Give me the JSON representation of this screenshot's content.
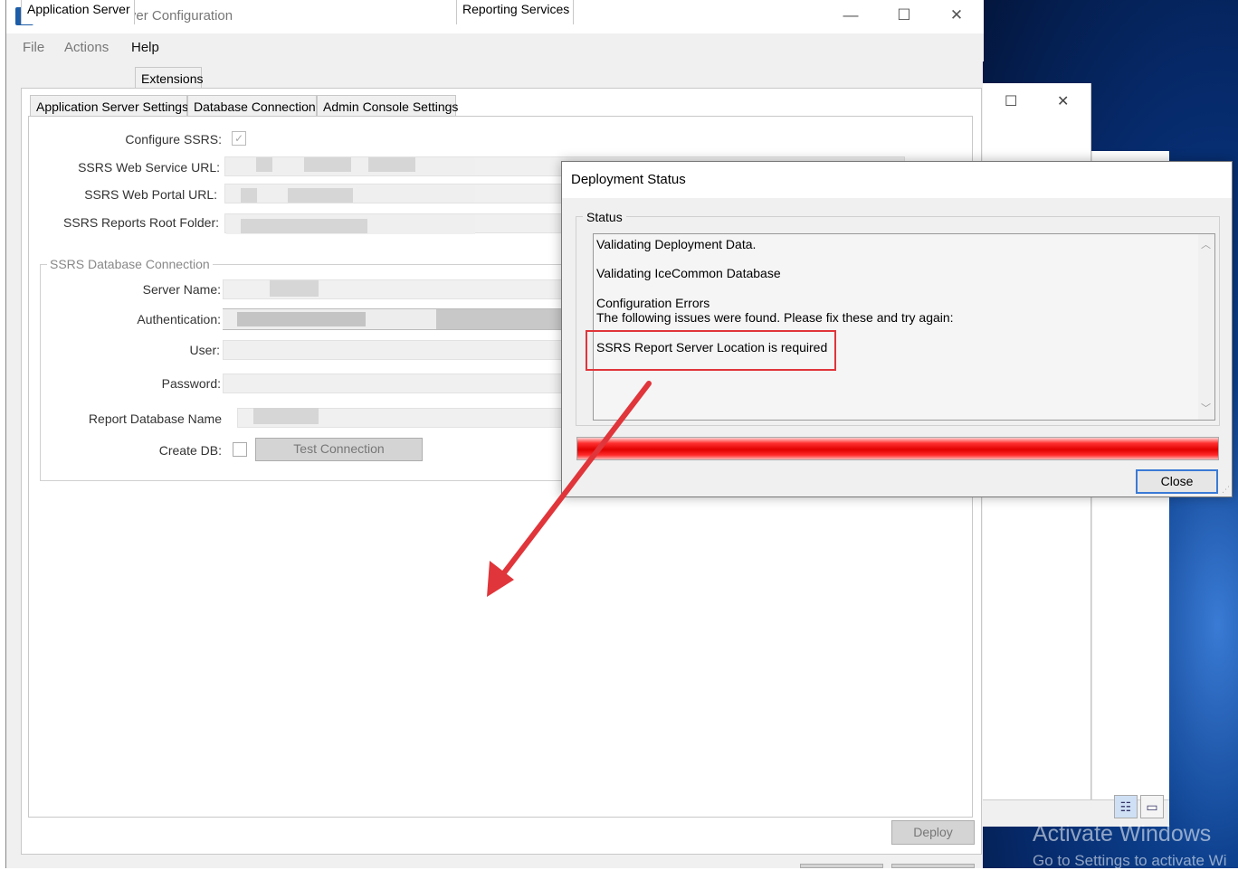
{
  "window": {
    "title": "Application Server Configuration",
    "app_icon_letter": "e",
    "minimize": "—",
    "maximize": "☐",
    "close": "✕"
  },
  "menu": {
    "file": "File",
    "actions": "Actions",
    "help": "Help"
  },
  "top_tabs": [
    "Application Server",
    "Extensions"
  ],
  "sub_tabs": [
    "Application Server Settings",
    "Database Connection",
    "Admin Console Settings",
    "Reporting Services"
  ],
  "form": {
    "configure_ssrs_label": "Configure SSRS:",
    "configure_ssrs_checked": true,
    "web_service_url_label": "SSRS Web Service URL:",
    "web_portal_url_label": "SSRS Web Portal URL:",
    "reports_root_folder_label": "SSRS Reports Root Folder:",
    "db_group_title": "SSRS Database Connection",
    "server_name_label": "Server Name:",
    "authentication_label": "Authentication:",
    "user_label": "User:",
    "password_label": "Password:",
    "report_db_name_label": "Report Database Name",
    "create_db_label": "Create DB:",
    "test_connection_button": "Test Connection"
  },
  "deploy_button": "Deploy",
  "dialog": {
    "title": "Deployment Status",
    "status_group": "Status",
    "messages": [
      "Validating Deployment Data.",
      "Validating IceCommon Database",
      "Configuration Errors",
      "The following issues were found. Please fix these and try again:",
      "SSRS Report Server Location is required"
    ],
    "close_button": "Close",
    "progress_color": "#e00000"
  },
  "background_window": {
    "maximize": "☐",
    "close": "✕"
  },
  "watermark": {
    "line1": "Activate Windows",
    "line2": "Go to Settings to activate Wi"
  },
  "annotation": {
    "highlight_color": "#e0353a",
    "arrow_color": "#e0353a"
  }
}
